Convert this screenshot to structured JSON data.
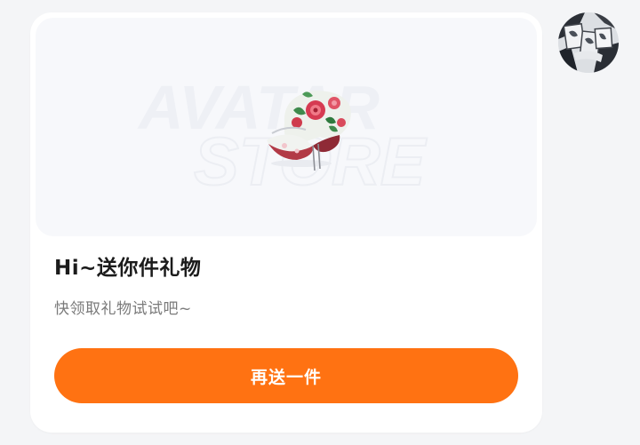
{
  "gift_card": {
    "preview": {
      "watermark_line1": "AVATAR",
      "watermark_line2": "STORE",
      "item_icon": "floral-beanie-hat-icon"
    },
    "title": "Hi~送你件礼物",
    "subtitle": "快领取礼物试试吧~",
    "action_button_label": "再送一件"
  },
  "user": {
    "avatar_icon": "user-avatar-photo"
  },
  "colors": {
    "page_background": "#f4f5f7",
    "card_background": "#ffffff",
    "preview_background": "#f7f8fb",
    "accent": "#ff7212",
    "title_text": "#1b1b1b",
    "subtitle_text": "#7a7a7a"
  }
}
